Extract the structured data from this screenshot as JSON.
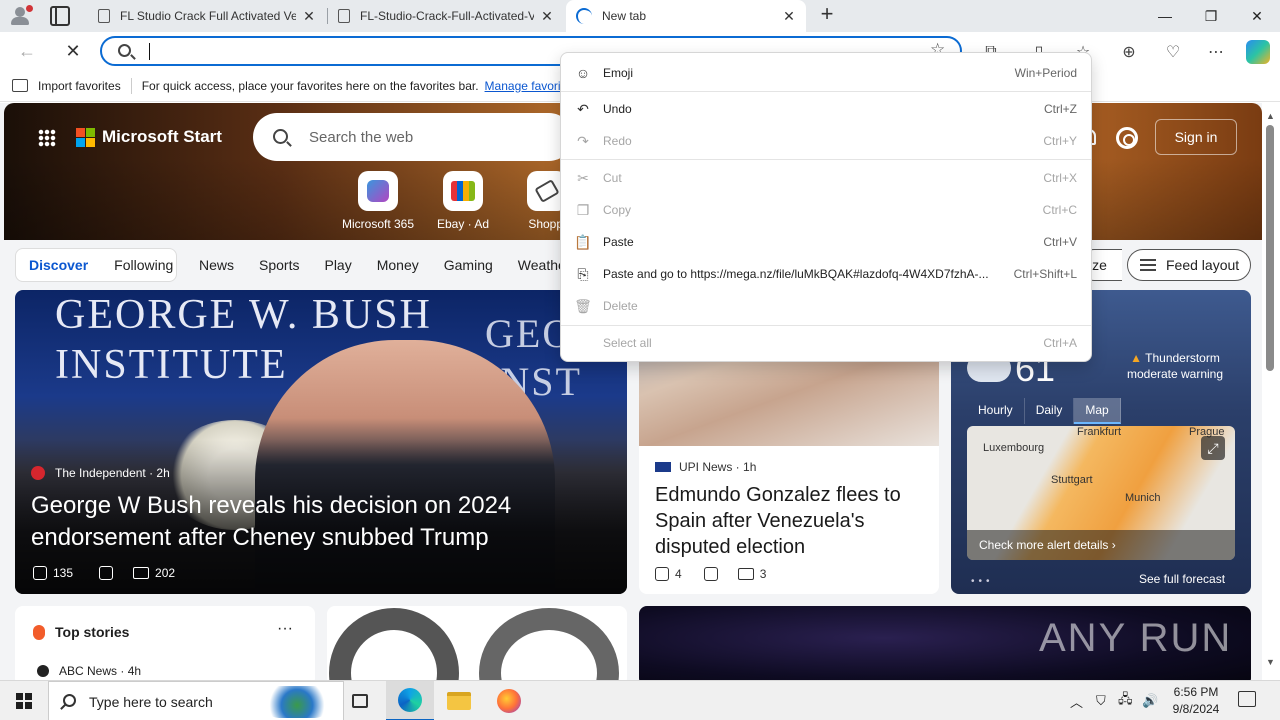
{
  "browser": {
    "tabs": [
      {
        "title": "FL Studio Crack Full Activated Ve",
        "active": false
      },
      {
        "title": "FL-Studio-Crack-Full-Activated-V",
        "active": false
      },
      {
        "title": "New tab",
        "active": true
      }
    ],
    "address_value": "",
    "favbar": {
      "import_label": "Import favorites",
      "hint": "For quick access, place your favorites here on the favorites bar.",
      "manage_link": "Manage favorites"
    }
  },
  "newtab": {
    "brand": "Microsoft Start",
    "search_placeholder": "Search the web",
    "sign_in": "Sign in",
    "shortcuts": [
      {
        "label": "Microsoft 365"
      },
      {
        "label": "Ebay · Ad"
      },
      {
        "label": "Shoppi"
      }
    ],
    "pills": [
      {
        "label": "Discover",
        "selected": true
      },
      {
        "label": "Following",
        "selected": false
      }
    ],
    "nav_links": [
      "News",
      "Sports",
      "Play",
      "Money",
      "Gaming",
      "Weather"
    ],
    "personalize_fragment": "ize",
    "feed_layout": "Feed layout",
    "big_story": {
      "banner_left": "GEORGE W. BUSH\nINSTITUTE",
      "banner_right": "GEOR\nINST",
      "source": "The Independent",
      "age": "2h",
      "headline": "George W Bush reveals his decision on 2024 endorsement after Cheney snubbed Trump",
      "likes": "135",
      "comments": "202"
    },
    "mid_story": {
      "source": "UPI News",
      "age": "1h",
      "headline": "Edmundo Gonzalez flees to Spain after Venezuela's disputed election",
      "likes": "4",
      "comments": "3"
    },
    "weather": {
      "temp": "61",
      "alert": "Thunderstorm moderate warning",
      "tabs": [
        {
          "label": "Hourly",
          "selected": false
        },
        {
          "label": "Daily",
          "selected": false
        },
        {
          "label": "Map",
          "selected": true
        }
      ],
      "map_labels": [
        "Frankfurt",
        "Prague",
        "Luxembourg",
        "Stuttgart",
        "Munich"
      ],
      "alert_link": "Check more alert details",
      "forecast_link": "See full forecast"
    },
    "top_stories": {
      "title": "Top stories",
      "first_source": "ABC News",
      "first_age": "4h"
    },
    "watermark": "ANY RUN"
  },
  "context_menu": {
    "items": [
      {
        "label": "Emoji",
        "shortcut": "Win+Period",
        "enabled": true,
        "icon": "emoji-icon"
      },
      {
        "label": "Undo",
        "shortcut": "Ctrl+Z",
        "enabled": true,
        "icon": "undo-icon"
      },
      {
        "label": "Redo",
        "shortcut": "Ctrl+Y",
        "enabled": false,
        "icon": "redo-icon"
      },
      {
        "label": "Cut",
        "shortcut": "Ctrl+X",
        "enabled": false,
        "icon": "cut-icon"
      },
      {
        "label": "Copy",
        "shortcut": "Ctrl+C",
        "enabled": false,
        "icon": "copy-icon"
      },
      {
        "label": "Paste",
        "shortcut": "Ctrl+V",
        "enabled": true,
        "icon": "paste-icon"
      },
      {
        "label": "Paste and go to https://mega.nz/file/luMkBQAK#lazdofq-4W4XD7fzhA-...",
        "shortcut": "Ctrl+Shift+L",
        "enabled": true,
        "icon": "paste-go-icon"
      },
      {
        "label": "Delete",
        "shortcut": "",
        "enabled": false,
        "icon": "delete-icon"
      },
      {
        "label": "Select all",
        "shortcut": "Ctrl+A",
        "enabled": false,
        "icon": ""
      }
    ]
  },
  "taskbar": {
    "search_placeholder": "Type here to search",
    "time": "6:56 PM",
    "date": "9/8/2024"
  }
}
